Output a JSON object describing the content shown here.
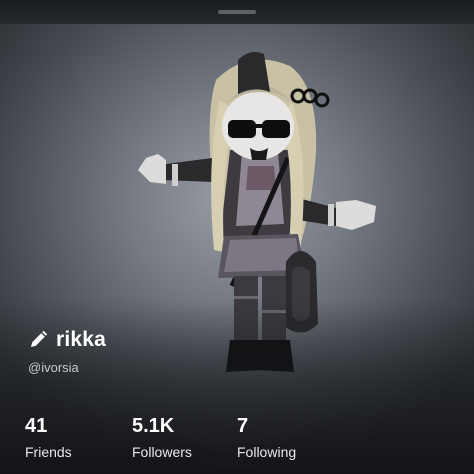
{
  "profile": {
    "display_name": "rikka",
    "username": "@ivorsia",
    "edit_icon": "pencil-icon"
  },
  "stats": [
    {
      "value": "41",
      "label": "Friends"
    },
    {
      "value": "5.1K",
      "label": "Followers"
    },
    {
      "value": "7",
      "label": "Following"
    }
  ],
  "colors": {
    "background": "#6d7179",
    "text_primary": "#ffffff",
    "text_secondary": "#c6c9ce"
  }
}
